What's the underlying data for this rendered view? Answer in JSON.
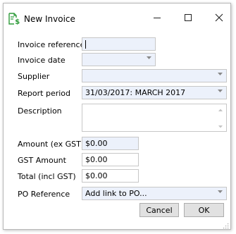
{
  "window": {
    "title": "New Invoice",
    "icon": "invoice-dollar-icon",
    "controls": {
      "minimize": "minimize-icon",
      "maximize": "maximize-icon",
      "close": "close-icon"
    }
  },
  "form": {
    "invoice_reference": {
      "label": "Invoice reference",
      "value": ""
    },
    "invoice_date": {
      "label": "Invoice date",
      "value": ""
    },
    "supplier": {
      "label": "Supplier",
      "value": ""
    },
    "report_period": {
      "label": "Report period",
      "value": "31/03/2017: MARCH 2017"
    },
    "description": {
      "label": "Description",
      "value": ""
    },
    "amount_ex_gst": {
      "label": "Amount (ex GST)",
      "value": "$0.00"
    },
    "gst_amount": {
      "label": "GST Amount",
      "value": "$0.00"
    },
    "total_incl_gst": {
      "label": "Total (incl GST)",
      "value": "$0.00"
    },
    "po_reference": {
      "label": "PO Reference",
      "value": "Add link to PO..."
    }
  },
  "buttons": {
    "cancel": "Cancel",
    "ok": "OK"
  },
  "colors": {
    "field_bg": "#ecf1fb",
    "icon_green": "#2e9b3a"
  }
}
